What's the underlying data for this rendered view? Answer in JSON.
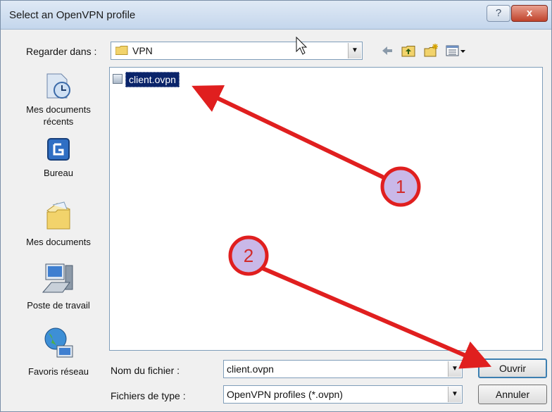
{
  "window": {
    "title": "Select an OpenVPN profile",
    "help_glyph": "?",
    "close_glyph": "x"
  },
  "look_in": {
    "label": "Regarder dans :",
    "value": "VPN"
  },
  "toolbar": [
    "back-icon",
    "up-folder-icon",
    "new-folder-icon",
    "view-menu-icon"
  ],
  "places": [
    {
      "label": "Mes documents récents",
      "icon": "recent-documents-icon"
    },
    {
      "label": "Bureau",
      "icon": "desktop-icon"
    },
    {
      "label": "Mes documents",
      "icon": "my-documents-icon"
    },
    {
      "label": "Poste de travail",
      "icon": "my-computer-icon"
    },
    {
      "label": "Favoris réseau",
      "icon": "network-places-icon"
    }
  ],
  "files": [
    {
      "name": "client.ovpn",
      "selected": true
    }
  ],
  "filename": {
    "label": "Nom du fichier :",
    "value": "client.ovpn"
  },
  "filetype": {
    "label": "Fichiers de type :",
    "value": "OpenVPN profiles (*.ovpn)"
  },
  "buttons": {
    "open": "Ouvrir",
    "cancel": "Annuler"
  },
  "annotations": [
    {
      "number": "1"
    },
    {
      "number": "2"
    }
  ],
  "colors": {
    "annotation": "#e01f1f",
    "badge_fill": "#c9b8e8",
    "selection": "#0a246a"
  }
}
